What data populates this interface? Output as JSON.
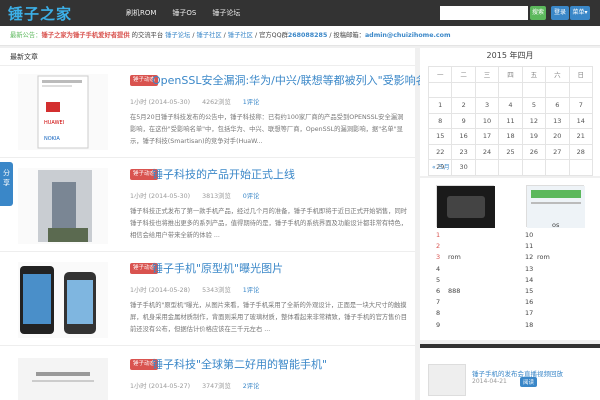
{
  "header": {
    "logo": "锤子之家",
    "nav": [
      "刷机ROM",
      "锤子OS",
      "锤子论坛"
    ],
    "search_placeholder": "",
    "search_btn": "搜索",
    "login_btn": "登录",
    "menu_btn": "菜单▾"
  },
  "infobar": {
    "p1": "最新公告：",
    "p2": "锤子之家为锤子手机爱好者提供",
    "p3": " 的交流平台 ",
    "l1": "锤子论坛",
    "s1": " / ",
    "l2": "锤子社区",
    "s2": " / ",
    "l3": "锤子社区",
    "s3": " / 官方QQ群",
    "qq": "268088285",
    "s4": " / 投稿邮箱：",
    "mail": "admin@chuizihome.com"
  },
  "main": {
    "heading": "最新文章",
    "posts": [
      {
        "tag": "锤子动态",
        "title": "OpenSSL安全漏洞:华为/中兴/联想等都被列入\"受影响名单\"",
        "date": "1小时 (2014-05-30)",
        "views": "4262浏览",
        "comments": "1评论",
        "excerpt": "在5月20日锤子科技发布的公告中，锤子科技称：已有约100家厂商的产品受到OPENSSL安全漏洞影响，在这份\"受影响名单\"中，包括华为、中兴、联想等厂商，OpenSSL的漏洞影响，据\"名单\"显示，锤子科技(Smartisan)的竞争对手(HuaW..."
      },
      {
        "tag": "锤子动态",
        "title": "锤子科技的产品开始正式上线",
        "date": "1小时 (2014-05-30)",
        "views": "3813浏览",
        "comments": "0评论",
        "excerpt": "锤子科技正式发布了第一款手机产品，经过几个月的准备，锤子手机即将于近日正式开始销售，同时锤子科技也将推出更多的系列产品，值得期待的是，锤子手机的系统界面及功能设计都非常有特色，相信会给用户带来全新的体验 ..."
      },
      {
        "tag": "锤子动态",
        "title": "锤子手机\"原型机\"曝光图片",
        "date": "1小时 (2014-05-28)",
        "views": "5343浏览",
        "comments": "1评论",
        "excerpt": "锤子手机的\"原型机\"曝光，从图片来看，锤子手机采用了全新的外观设计，正面是一块大尺寸的触摸屏，机身采用金属材质制作，背面则采用了玻璃材质，整体看起来非常精致，锤子手机的官方售价目前还没有公布，但据估计价格应该在三千元左右 ..."
      },
      {
        "tag": "锤子动态",
        "title": "锤子科技\"全球第二好用的智能手机\"",
        "date": "1小时 (2014-05-27)",
        "views": "3747浏览",
        "comments": "2评论",
        "excerpt": ""
      }
    ]
  },
  "share": "分享",
  "calendar": {
    "title": "2015 年四月",
    "headers": [
      "一",
      "二",
      "三",
      "四",
      "五",
      "六",
      "日"
    ],
    "rows": [
      [
        "",
        "",
        "",
        "",
        "",
        "",
        ""
      ],
      [
        "1",
        "2",
        "3",
        "4",
        "5",
        "6",
        "7"
      ],
      [
        "8",
        "9",
        "10",
        "11",
        "12",
        "13",
        "14"
      ],
      [
        "15",
        "16",
        "17",
        "18",
        "19",
        "20",
        "21"
      ],
      [
        "22",
        "23",
        "24",
        "25",
        "26",
        "27",
        "28"
      ],
      [
        "29",
        "30",
        "",
        "",
        "",
        "",
        ""
      ]
    ],
    "prev": "« 三月"
  },
  "ranking": {
    "left": [
      {
        "n": "1",
        "t": ""
      },
      {
        "n": "2",
        "t": ""
      },
      {
        "n": "3",
        "t": "rom"
      },
      {
        "n": "4",
        "t": ""
      },
      {
        "n": "5",
        "t": ""
      },
      {
        "n": "6",
        "t": "888"
      },
      {
        "n": "7",
        "t": ""
      },
      {
        "n": "8",
        "t": ""
      },
      {
        "n": "9",
        "t": ""
      }
    ],
    "right": [
      {
        "n": "10",
        "t": ""
      },
      {
        "n": "11",
        "t": ""
      },
      {
        "n": "12",
        "t": "rom"
      },
      {
        "n": "13",
        "t": ""
      },
      {
        "n": "14",
        "t": ""
      },
      {
        "n": "15",
        "t": ""
      },
      {
        "n": "16",
        "t": ""
      },
      {
        "n": "17",
        "t": ""
      },
      {
        "n": "18",
        "t": ""
      }
    ],
    "os_label": "os"
  },
  "side3": {
    "title": "锤子手机的发布会直播视频回放",
    "date": "2014-04-21",
    "btn": "阅读"
  }
}
